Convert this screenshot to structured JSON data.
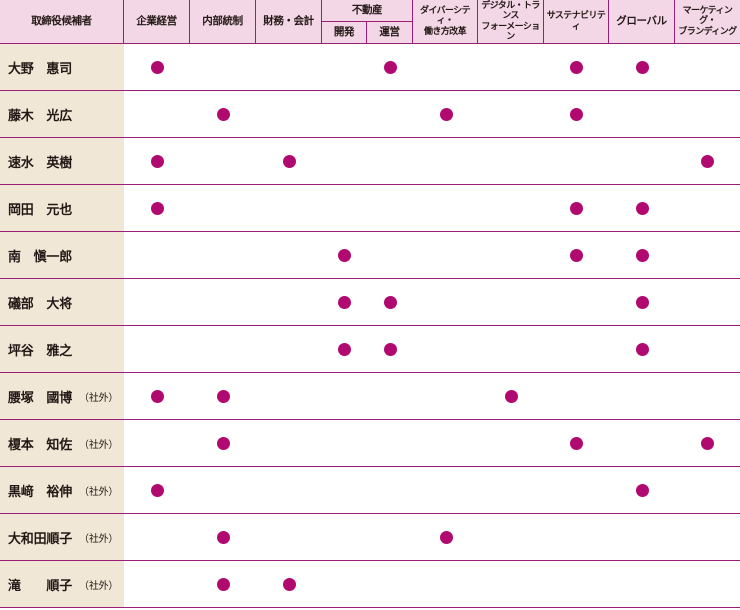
{
  "table": {
    "header": {
      "name_col": "取締役候補者",
      "columns": [
        "企業経営",
        "内部統制",
        "財務・会計",
        "不動産",
        "ダイバーシティ・働き方改革",
        "デジタル・トランスフォーメーション",
        "サステナビリティ",
        "グローバル",
        "マーケティング・ブランディング"
      ],
      "real_estate_group": "不動産",
      "real_estate_sub": [
        "開発",
        "運営"
      ],
      "diversity_lines": [
        "ダイバーシティ・",
        "働き方改革"
      ],
      "digital_lines": [
        "デジタル・トランス",
        "フォーメーション"
      ],
      "marketing_lines": [
        "マーケティング・",
        "ブランディング"
      ]
    },
    "dot_color": "#b0096f",
    "header_bg": "#f4d7e7",
    "name_bg": "#f0e7d6",
    "line_color": "#9a1f74",
    "rows": [
      {
        "name": "大野　惠司",
        "outside": "",
        "marks": [
          1,
          0,
          0,
          0,
          1,
          0,
          0,
          1,
          1,
          0
        ]
      },
      {
        "name": "藤木　光広",
        "outside": "",
        "marks": [
          0,
          1,
          0,
          0,
          0,
          1,
          0,
          1,
          0,
          0
        ]
      },
      {
        "name": "速水　英樹",
        "outside": "",
        "marks": [
          1,
          0,
          1,
          0,
          0,
          0,
          0,
          0,
          0,
          1
        ]
      },
      {
        "name": "岡田　元也",
        "outside": "",
        "marks": [
          1,
          0,
          0,
          0,
          0,
          0,
          0,
          1,
          1,
          0
        ]
      },
      {
        "name": "南　愼一郎",
        "outside": "",
        "marks": [
          0,
          0,
          0,
          1,
          0,
          0,
          0,
          1,
          1,
          0
        ]
      },
      {
        "name": "礒部　大将",
        "outside": "",
        "marks": [
          0,
          0,
          0,
          1,
          1,
          0,
          0,
          0,
          1,
          0
        ]
      },
      {
        "name": "坪谷　雅之",
        "outside": "",
        "marks": [
          0,
          0,
          0,
          1,
          1,
          0,
          0,
          0,
          1,
          0
        ]
      },
      {
        "name": "腰塚　國博",
        "outside": "（社外）",
        "marks": [
          1,
          1,
          0,
          0,
          0,
          0,
          1,
          0,
          0,
          0
        ]
      },
      {
        "name": "榎本　知佐",
        "outside": "（社外）",
        "marks": [
          0,
          1,
          0,
          0,
          0,
          0,
          0,
          1,
          0,
          1
        ]
      },
      {
        "name": "黒﨑　裕伸",
        "outside": "（社外）",
        "marks": [
          1,
          0,
          0,
          0,
          0,
          0,
          0,
          0,
          1,
          0
        ]
      },
      {
        "name": "大和田順子",
        "outside": "（社外）",
        "marks": [
          0,
          1,
          0,
          0,
          0,
          1,
          0,
          0,
          0,
          0
        ]
      },
      {
        "name": "滝　　順子",
        "outside": "（社外）",
        "marks": [
          0,
          1,
          1,
          0,
          0,
          0,
          0,
          0,
          0,
          0
        ]
      }
    ]
  }
}
